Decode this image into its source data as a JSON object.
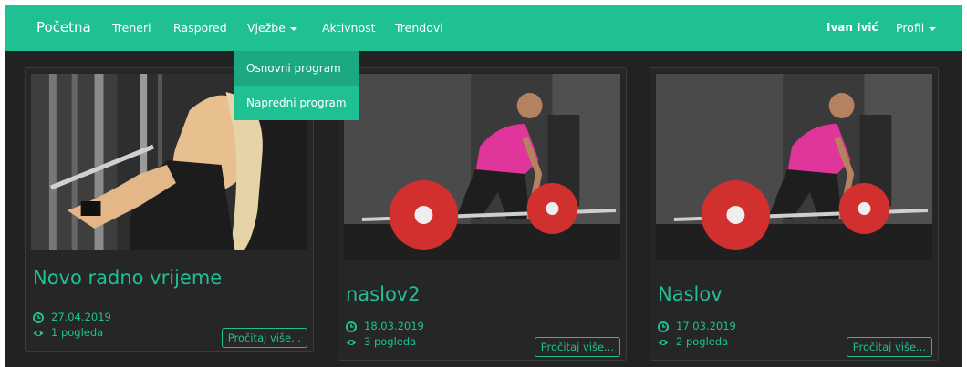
{
  "navbar": {
    "brand": "Početna",
    "links": [
      "Treneri",
      "Raspored",
      "Vježbe",
      "Aktivnost",
      "Trendovi"
    ],
    "user": "Ivan Ivić",
    "profile": "Profil"
  },
  "dropdown": {
    "items": [
      "Osnovni program",
      "Napredni program"
    ],
    "active_index": 0
  },
  "cards": [
    {
      "title": "Novo radno vrijeme",
      "date": "27.04.2019",
      "views": "1 pogleda",
      "read_more": "Pročitaj više..."
    },
    {
      "title": "naslov2",
      "date": "18.03.2019",
      "views": "3 pogleda",
      "read_more": "Pročitaj više..."
    },
    {
      "title": "Naslov",
      "date": "17.03.2019",
      "views": "2 pogleda",
      "read_more": "Pročitaj više..."
    }
  ],
  "colors": {
    "accent": "#20c095",
    "background": "#222222",
    "card": "#262626"
  }
}
